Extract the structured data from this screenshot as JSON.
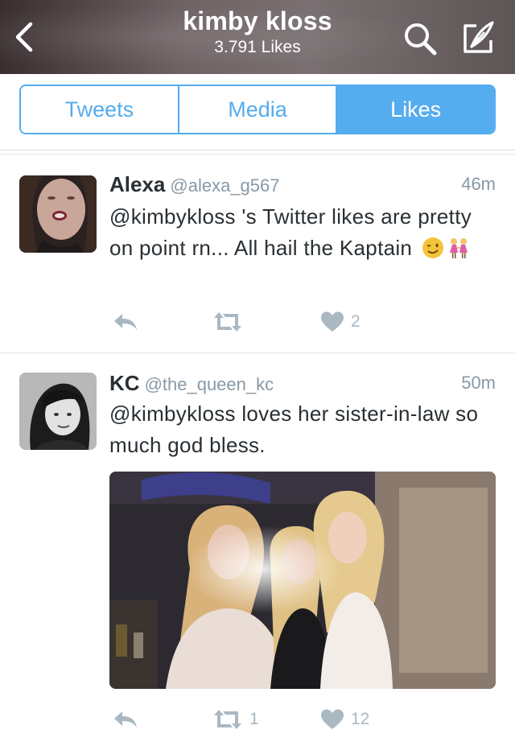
{
  "header": {
    "title": "kimby kloss",
    "subtitle": "3.791 Likes",
    "colors": {
      "background": "#6e6264",
      "text": "#ffffff"
    }
  },
  "tabs": [
    {
      "label": "Tweets",
      "active": false
    },
    {
      "label": "Media",
      "active": false
    },
    {
      "label": "Likes",
      "active": true
    }
  ],
  "accent_color": "#55acee",
  "tweets": [
    {
      "name": "Alexa",
      "handle": "@alexa_g567",
      "time": "46m",
      "text": "@kimbykloss 's Twitter likes are pretty on point rn... All hail the Kaptain",
      "emojis": [
        "winking-face-emoji",
        "women-holding-hands-emoji"
      ],
      "retweets": "",
      "likes": "2"
    },
    {
      "name": "KC",
      "handle": "@the_queen_kc",
      "time": "50m",
      "text": "@kimbykloss loves her sister-in-law so much god bless.",
      "has_photo": true,
      "retweets": "1",
      "likes": "12"
    }
  ]
}
